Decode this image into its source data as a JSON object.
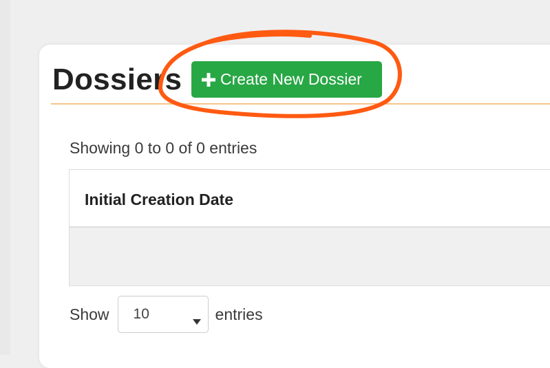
{
  "header": {
    "title": "Dossiers",
    "create_button_label": "Create New Dossier",
    "create_button_icon": "plus-icon",
    "accent_color": "#28a745",
    "underline_color": "#f6c48a",
    "annotation_color": "#ff5a12"
  },
  "table": {
    "info": "Showing 0 to 0 of 0 entries",
    "columns": [
      "Initial Creation Date"
    ],
    "rows": []
  },
  "length_menu": {
    "prefix": "Show",
    "selected": "10",
    "suffix": "entries",
    "caret_icon": "caret-down-icon"
  }
}
